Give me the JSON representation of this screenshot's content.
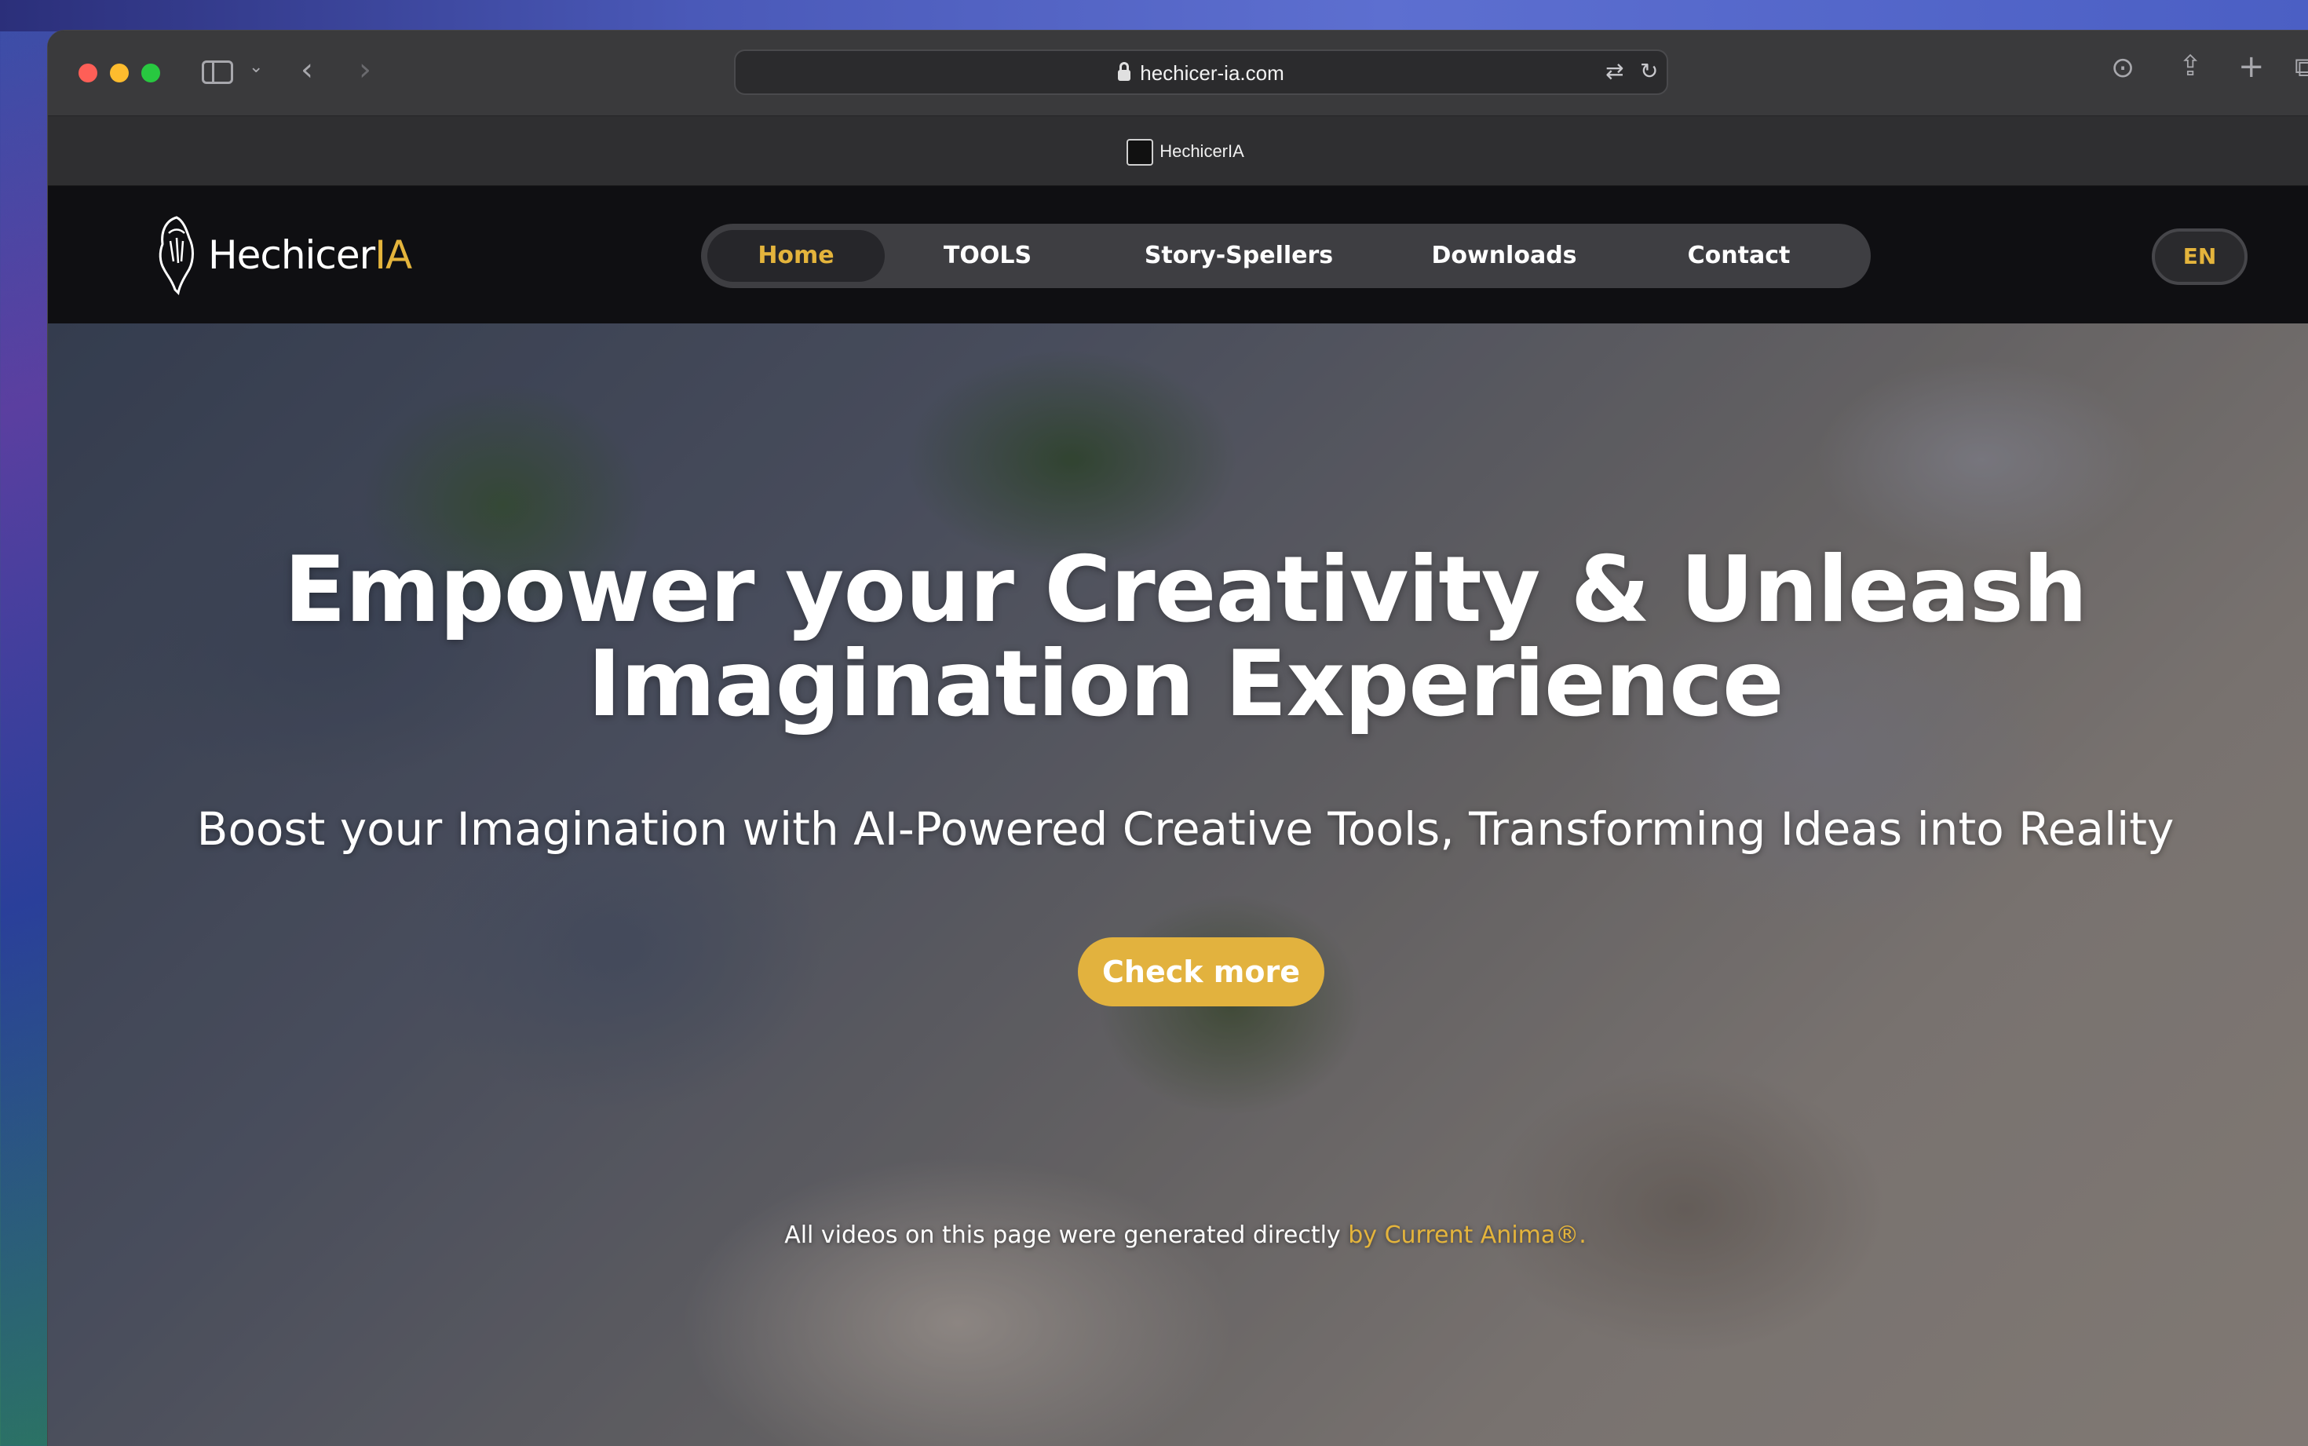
{
  "browser": {
    "url": "hechicer-ia.com",
    "tab_title": "HechicerIA"
  },
  "site": {
    "logo_text": "Hechicer",
    "logo_accent": "IA",
    "nav": [
      {
        "label": "Home",
        "active": true
      },
      {
        "label": "TOOLS"
      },
      {
        "label": "Story-Spellers"
      },
      {
        "label": "Downloads"
      },
      {
        "label": "Contact"
      }
    ],
    "lang": "EN"
  },
  "hero": {
    "title_line1": "Empower your Creativity & Unleash",
    "title_line2": "Imagination Experience",
    "subtitle": "Boost your Imagination with AI-Powered Creative Tools, Transforming Ideas into Reality",
    "cta": "Check more",
    "note": "All videos on this page were generated directly ",
    "note_link": "by Current Anima®."
  },
  "colors": {
    "accent": "#e4b43c",
    "header_bg": "#0f0f12",
    "nav_bg": "#3e3e42"
  }
}
